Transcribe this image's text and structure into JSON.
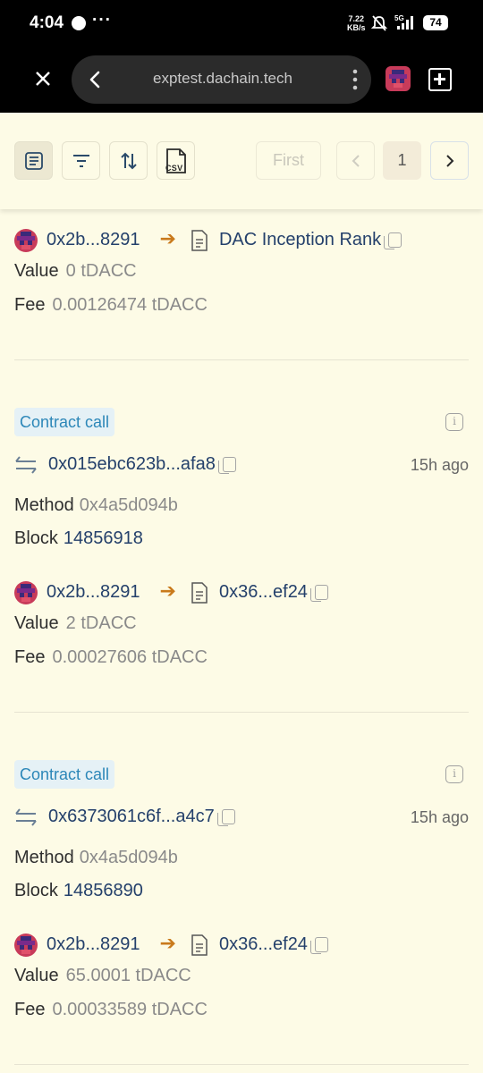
{
  "status_bar": {
    "time": "4:04",
    "dots": "···",
    "net_speed_top": "7.22",
    "net_speed_bottom": "KB/s",
    "net_type": "5G",
    "battery": "74"
  },
  "browser": {
    "url": "exptest.dachain.tech"
  },
  "toolbar": {
    "first_label": "First",
    "page_number": "1",
    "csv_label": "CSV"
  },
  "colors": {
    "background": "#fdfbe6",
    "link": "#24406b",
    "badge_bg": "#e5f1f6",
    "badge_text": "#2c87b8",
    "arrow": "#c97a1c"
  },
  "transactions": [
    {
      "from": "0x2b...8291",
      "to": "DAC Inception Rank",
      "value_label": "Value",
      "value": "0 tDACC",
      "fee_label": "Fee",
      "fee": "0.00126474 tDACC"
    },
    {
      "type": "Contract call",
      "hash": "0x015ebc623b...afa8",
      "age": "15h ago",
      "method_label": "Method",
      "method": "0x4a5d094b",
      "block_label": "Block",
      "block": "14856918",
      "from": "0x2b...8291",
      "to": "0x36...ef24",
      "value_label": "Value",
      "value": "2 tDACC",
      "fee_label": "Fee",
      "fee": "0.00027606 tDACC"
    },
    {
      "type": "Contract call",
      "hash": "0x6373061c6f...a4c7",
      "age": "15h ago",
      "method_label": "Method",
      "method": "0x4a5d094b",
      "block_label": "Block",
      "block": "14856890",
      "from": "0x2b...8291",
      "to": "0x36...ef24",
      "value_label": "Value",
      "value": "65.0001 tDACC",
      "fee_label": "Fee",
      "fee": "0.00033589 tDACC"
    }
  ]
}
